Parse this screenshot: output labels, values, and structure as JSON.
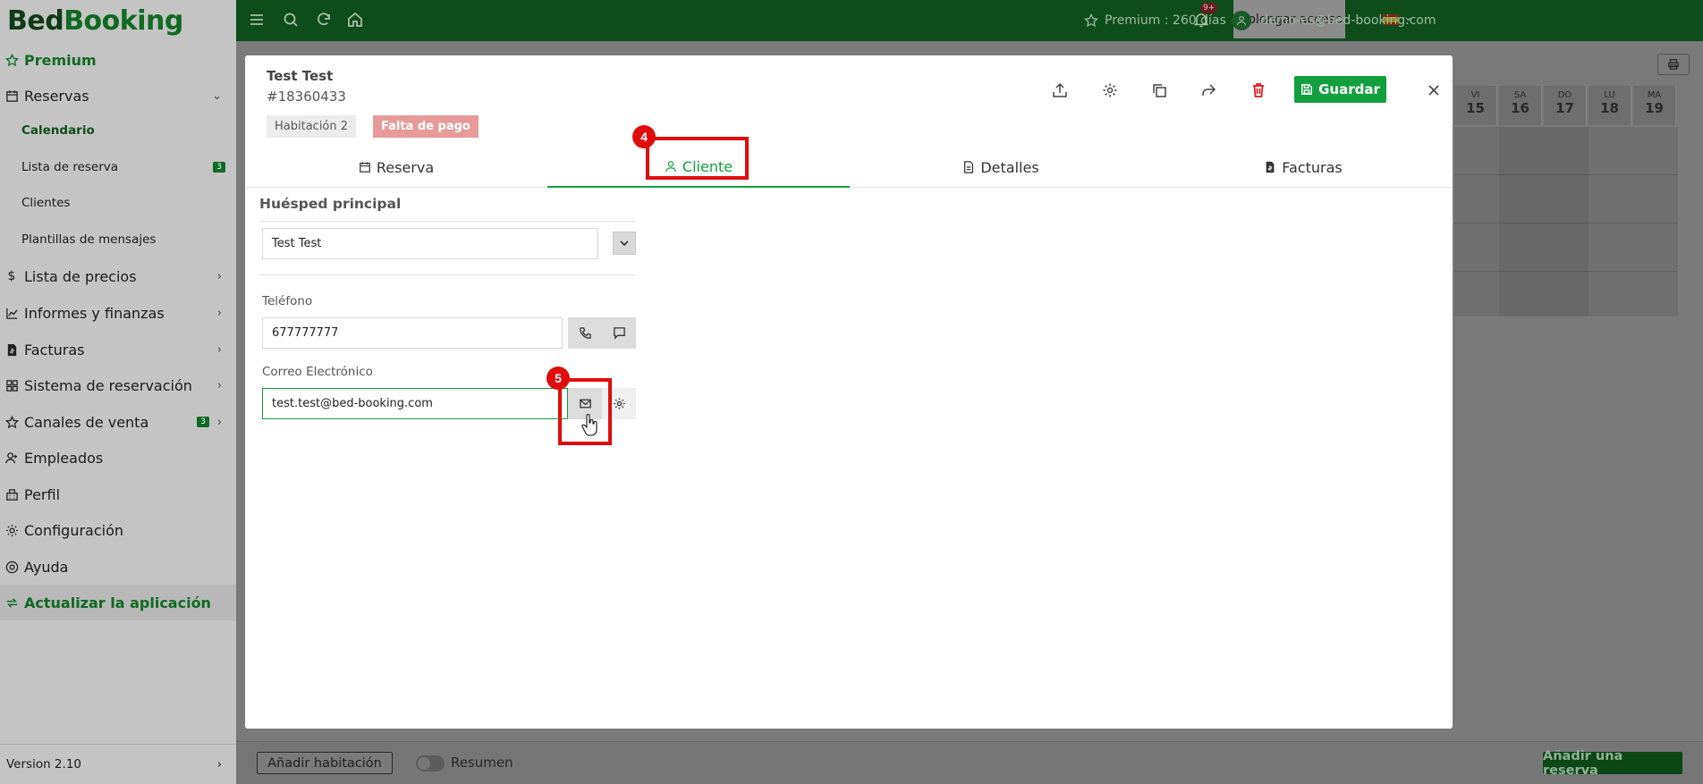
{
  "app": {
    "logo_bed": "Bed",
    "logo_booking": "Booking"
  },
  "sidebar": {
    "premium": "Premium",
    "reservas": "Reservas",
    "sub": [
      {
        "label": "Calendario"
      },
      {
        "label": "Lista de reserva",
        "badge": "3"
      },
      {
        "label": "Clientes"
      },
      {
        "label": "Plantillas de mensajes"
      }
    ],
    "items": [
      {
        "label": "Lista de precios"
      },
      {
        "label": "Informes y finanzas"
      },
      {
        "label": "Facturas"
      },
      {
        "label": "Sistema de reservación"
      },
      {
        "label": "Canales de venta",
        "badge": "3"
      },
      {
        "label": "Empleados"
      },
      {
        "label": "Perfil"
      },
      {
        "label": "Configuración"
      },
      {
        "label": "Ayuda"
      }
    ],
    "update": "Actualizar la aplicación",
    "version": "Version 2.10"
  },
  "topbar": {
    "premium": "Premium : 260 días",
    "prolongar": "Prolongar acceso",
    "notif_badge": "9+",
    "user": "demo-es@bed-booking.com"
  },
  "calendar": {
    "days": [
      {
        "name": "VI",
        "num": "15"
      },
      {
        "name": "SA",
        "num": "16"
      },
      {
        "name": "DO",
        "num": "17"
      },
      {
        "name": "LU",
        "num": "18"
      },
      {
        "name": "MA",
        "num": "19"
      }
    ]
  },
  "bottom": {
    "add_room": "Añadir habitación",
    "summary": "Resumen",
    "add_reservation": "Añadir una reserva"
  },
  "modal": {
    "guest_name": "Test Test",
    "booking_number": "#18360433",
    "room_tag": "Habitación 2",
    "payment_tag": "Falta de pago",
    "save": "Guardar",
    "tabs": [
      {
        "label": "Reserva"
      },
      {
        "label": "Cliente",
        "active": true
      },
      {
        "label": "Detalles"
      },
      {
        "label": "Facturas"
      }
    ],
    "section_title": "Huésped principal",
    "guest_select_value": "Test Test",
    "phone_label": "Teléfono",
    "phone_value": "677777777",
    "email_label": "Correo Electrónico",
    "email_value": "test.test@bed-booking.com"
  },
  "annotations": {
    "step4": "4",
    "step5": "5"
  },
  "colors": {
    "brand_green": "#0f6a24",
    "accent_green": "#12a03e",
    "highlight_red": "#e00d0d",
    "unpaid_tag": "#e79a9a"
  }
}
